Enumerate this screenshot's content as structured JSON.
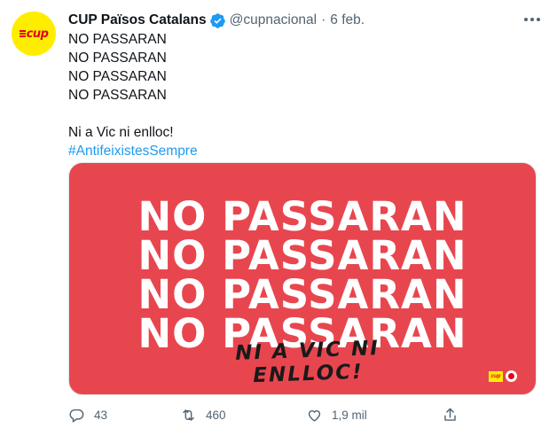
{
  "author": {
    "display_name": "CUP Països Catalans",
    "handle": "@cupnacional",
    "date": "6 feb.",
    "separator": "·",
    "avatar_text": "cup",
    "verified": true
  },
  "tweet": {
    "lines": [
      "NO PASSARAN",
      "NO PASSARAN",
      "NO PASSARAN",
      "NO PASSARAN"
    ],
    "closing": "Ni a Vic ni enlloc!",
    "hashtag": "#AntifeixistesSempre"
  },
  "media": {
    "background": "#e8464f",
    "headline_lines": [
      "NO PASSARAN",
      "NO PASSARAN",
      "NO PASSARAN",
      "NO PASSARAN"
    ],
    "slogan": "NI A VIC NI ENLLOC!",
    "logo_text": "cup"
  },
  "actions": {
    "reply": {
      "icon": "reply-icon",
      "count": "43"
    },
    "retweet": {
      "icon": "retweet-icon",
      "count": "460"
    },
    "like": {
      "icon": "heart-icon",
      "count": "1,9 mil"
    },
    "share": {
      "icon": "share-icon",
      "count": ""
    }
  },
  "colors": {
    "accent": "#1d9bf0",
    "secondary_text": "#536471",
    "brand_yellow": "#ffed00",
    "brand_red": "#e2001a"
  }
}
